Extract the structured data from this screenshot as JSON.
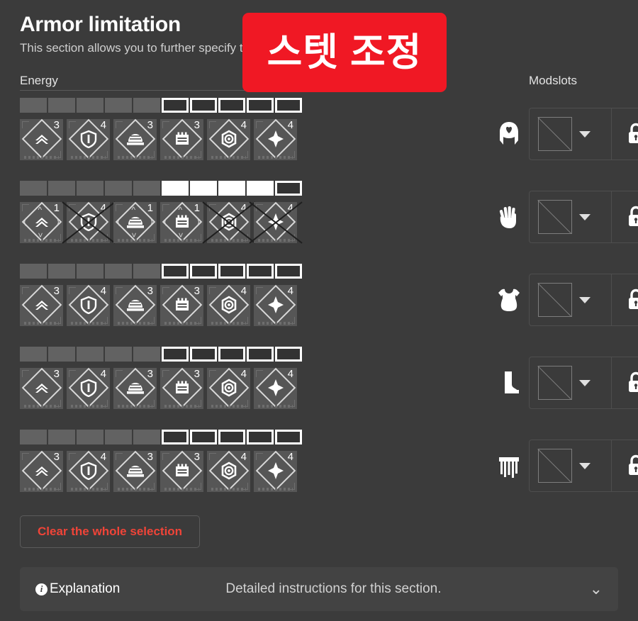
{
  "header": {
    "title": "Armor limitation",
    "subtitle": "This section allows you to further specify the mods you want."
  },
  "annotation": {
    "text": "스텟 조정",
    "background": "#f01824",
    "text_color": "#ffffff"
  },
  "columns": {
    "energy_label": "Energy",
    "modslots_label": "Modslots"
  },
  "colors": {
    "panel_bg": "#3b3b3b",
    "page_bg": "#2f2f2f",
    "energy_used": "#626262",
    "energy_empty_border": "#ffffff",
    "energy_full": "#ffffff",
    "mod_tile": "#565656",
    "danger": "#f04438"
  },
  "rows": [
    {
      "slot": "helmet",
      "slot_icon": "helmet-icon",
      "energy": {
        "used": 5,
        "full": 0,
        "empty": 5,
        "total": 10
      },
      "mods": [
        {
          "glyph": "mobility-icon",
          "count": "3",
          "state": "normal"
        },
        {
          "glyph": "resilience-icon",
          "count": "4",
          "state": "normal"
        },
        {
          "glyph": "recovery-icon",
          "count": "3",
          "state": "normal"
        },
        {
          "glyph": "discipline-icon",
          "count": "3",
          "state": "normal"
        },
        {
          "glyph": "intellect-icon",
          "count": "4",
          "state": "normal"
        },
        {
          "glyph": "strength-icon",
          "count": "4",
          "state": "normal"
        }
      ],
      "modslot": {
        "value": "",
        "locked": true
      }
    },
    {
      "slot": "gauntlets",
      "slot_icon": "gauntlets-icon",
      "energy": {
        "used": 5,
        "full": 4,
        "empty": 1,
        "total": 10
      },
      "mods": [
        {
          "glyph": "mobility-icon",
          "count": "1",
          "state": "stepper"
        },
        {
          "glyph": "resilience-icon",
          "count": "4",
          "state": "disabled"
        },
        {
          "glyph": "recovery-icon",
          "count": "1",
          "state": "stepper"
        },
        {
          "glyph": "discipline-icon",
          "count": "1",
          "state": "stepper"
        },
        {
          "glyph": "intellect-icon",
          "count": "4",
          "state": "disabled"
        },
        {
          "glyph": "strength-icon",
          "count": "4",
          "state": "disabled"
        }
      ],
      "modslot": {
        "value": "",
        "locked": true
      }
    },
    {
      "slot": "chest",
      "slot_icon": "chest-armor-icon",
      "energy": {
        "used": 5,
        "full": 0,
        "empty": 5,
        "total": 10
      },
      "mods": [
        {
          "glyph": "mobility-icon",
          "count": "3",
          "state": "normal"
        },
        {
          "glyph": "resilience-icon",
          "count": "4",
          "state": "normal"
        },
        {
          "glyph": "recovery-icon",
          "count": "3",
          "state": "normal"
        },
        {
          "glyph": "discipline-icon",
          "count": "3",
          "state": "normal"
        },
        {
          "glyph": "intellect-icon",
          "count": "4",
          "state": "normal"
        },
        {
          "glyph": "strength-icon",
          "count": "4",
          "state": "normal"
        }
      ],
      "modslot": {
        "value": "",
        "locked": true
      }
    },
    {
      "slot": "legs",
      "slot_icon": "boots-icon",
      "energy": {
        "used": 5,
        "full": 0,
        "empty": 5,
        "total": 10
      },
      "mods": [
        {
          "glyph": "mobility-icon",
          "count": "3",
          "state": "normal"
        },
        {
          "glyph": "resilience-icon",
          "count": "4",
          "state": "normal"
        },
        {
          "glyph": "recovery-icon",
          "count": "3",
          "state": "normal"
        },
        {
          "glyph": "discipline-icon",
          "count": "3",
          "state": "normal"
        },
        {
          "glyph": "intellect-icon",
          "count": "4",
          "state": "normal"
        },
        {
          "glyph": "strength-icon",
          "count": "4",
          "state": "normal"
        }
      ],
      "modslot": {
        "value": "",
        "locked": true
      }
    },
    {
      "slot": "class-item",
      "slot_icon": "class-item-icon",
      "energy": {
        "used": 5,
        "full": 0,
        "empty": 5,
        "total": 10
      },
      "mods": [
        {
          "glyph": "mobility-icon",
          "count": "3",
          "state": "normal"
        },
        {
          "glyph": "resilience-icon",
          "count": "4",
          "state": "normal"
        },
        {
          "glyph": "recovery-icon",
          "count": "3",
          "state": "normal"
        },
        {
          "glyph": "discipline-icon",
          "count": "3",
          "state": "normal"
        },
        {
          "glyph": "intellect-icon",
          "count": "4",
          "state": "normal"
        },
        {
          "glyph": "strength-icon",
          "count": "4",
          "state": "normal"
        }
      ],
      "modslot": {
        "value": "",
        "locked": true
      }
    }
  ],
  "clear_button": {
    "label": "Clear the whole selection"
  },
  "explanation": {
    "label": "Explanation",
    "description": "Detailed instructions for this section.",
    "chevron": "⌄"
  }
}
